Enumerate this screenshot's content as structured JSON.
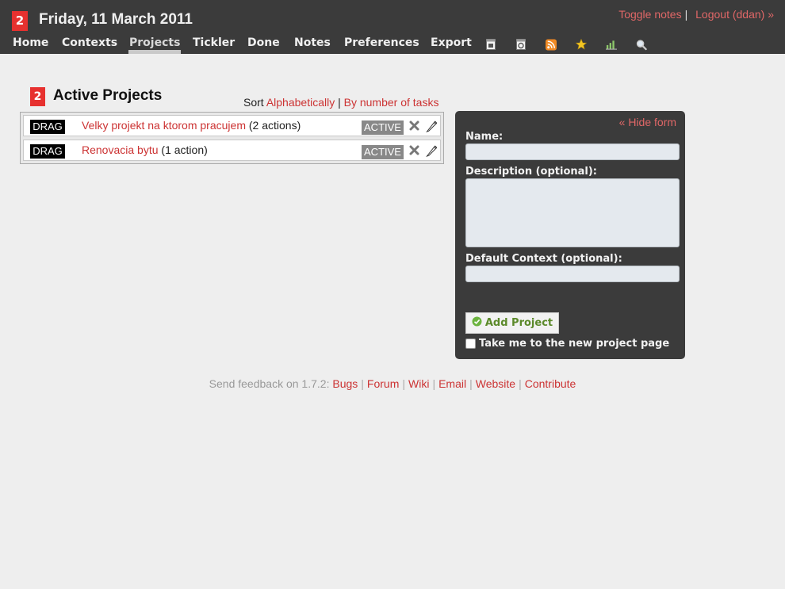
{
  "header": {
    "badge": "2",
    "date": "Friday, 11 March 2011",
    "toggle_notes": "Toggle notes",
    "separator": "|",
    "logout": "Logout (ddan) »"
  },
  "nav": {
    "items": [
      "Home",
      "Contexts",
      "Projects",
      "Tickler",
      "Done",
      "Notes",
      "Preferences",
      "Export"
    ],
    "active": "Projects",
    "icons": [
      "calendar-icon",
      "calendar-recurring-icon",
      "rss-icon",
      "star-icon",
      "stats-icon",
      "search-icon"
    ]
  },
  "projects_section": {
    "badge": "2",
    "title": "Active Projects",
    "sort_label": "Sort",
    "sort_alpha": "Alphabetically",
    "sort_sep": "|",
    "sort_tasks": "By number of tasks",
    "rows": [
      {
        "drag": "DRAG",
        "name": "Velky projekt na ktorom pracujem",
        "count": "(2 actions)",
        "status": "ACTIVE"
      },
      {
        "drag": "DRAG",
        "name": "Renovacia bytu",
        "count": "(1 action)",
        "status": "ACTIVE"
      }
    ]
  },
  "form": {
    "hide": "« Hide form",
    "name_label": "Name:",
    "name_value": "",
    "description_label": "Description (optional):",
    "description_value": "",
    "context_label": "Default Context (optional):",
    "context_value": "",
    "submit": "Add Project",
    "go_to_project": "Take me to the new project page",
    "go_to_project_checked": false
  },
  "footer": {
    "prefix": "Send feedback on 1.7.2:",
    "links": [
      "Bugs",
      "Forum",
      "Wiki",
      "Email",
      "Website",
      "Contribute"
    ]
  },
  "colors": {
    "header_bg": "#3b3b3b",
    "page_bg": "#eeeeee",
    "link": "#cc3333",
    "badge": "#e7312f",
    "status_bg": "#888888",
    "add_button_text": "#5c8a2b"
  }
}
